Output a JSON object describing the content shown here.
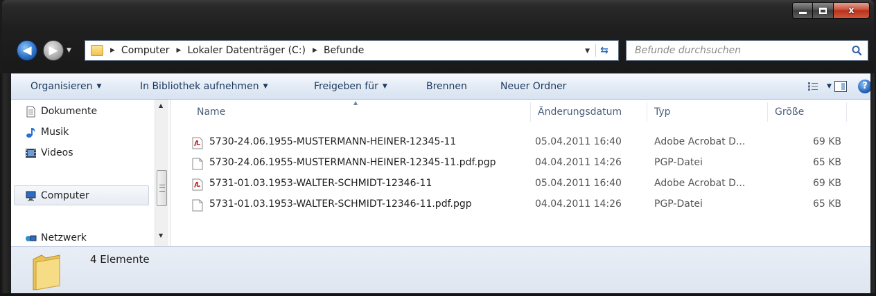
{
  "window": {
    "caption_buttons": {
      "minimize": "minimize",
      "maximize": "maximize",
      "close": "x"
    }
  },
  "address": {
    "breadcrumbs": [
      "Computer",
      "Lokaler Datenträger (C:)",
      "Befunde"
    ]
  },
  "search": {
    "placeholder": "Befunde durchsuchen"
  },
  "toolbar": {
    "organize": "Organisieren",
    "include_library": "In Bibliothek aufnehmen",
    "share": "Freigeben für",
    "burn": "Brennen",
    "new_folder": "Neuer Ordner",
    "help": "?"
  },
  "nav": {
    "items": [
      "Dokumente",
      "Musik",
      "Videos",
      "Computer",
      "Netzwerk"
    ]
  },
  "list": {
    "columns": [
      "Name",
      "Änderungsdatum",
      "Typ",
      "Größe"
    ],
    "rows": [
      {
        "name": "5730-24.06.1955-MUSTERMANN-HEINER-12345-11",
        "date": "05.04.2011 16:40",
        "type": "Adobe Acrobat D...",
        "size": "69 KB",
        "icon": "pdf-icon"
      },
      {
        "name": "5730-24.06.1955-MUSTERMANN-HEINER-12345-11.pdf.pgp",
        "date": "04.04.2011 14:26",
        "type": "PGP-Datei",
        "size": "65 KB",
        "icon": "file-icon"
      },
      {
        "name": "5731-01.03.1953-WALTER-SCHMIDT-12346-11",
        "date": "05.04.2011 16:40",
        "type": "Adobe Acrobat D...",
        "size": "69 KB",
        "icon": "pdf-icon"
      },
      {
        "name": "5731-01.03.1953-WALTER-SCHMIDT-12346-11.pdf.pgp",
        "date": "04.04.2011 14:26",
        "type": "PGP-Datei",
        "size": "65 KB",
        "icon": "file-icon"
      }
    ]
  },
  "details": {
    "count": "4 Elemente"
  },
  "colors": {
    "frame": "#1b1b1b",
    "toolbar_text": "#1e3a5f",
    "header_text": "#4c607a",
    "accent": "#2e73c7"
  }
}
